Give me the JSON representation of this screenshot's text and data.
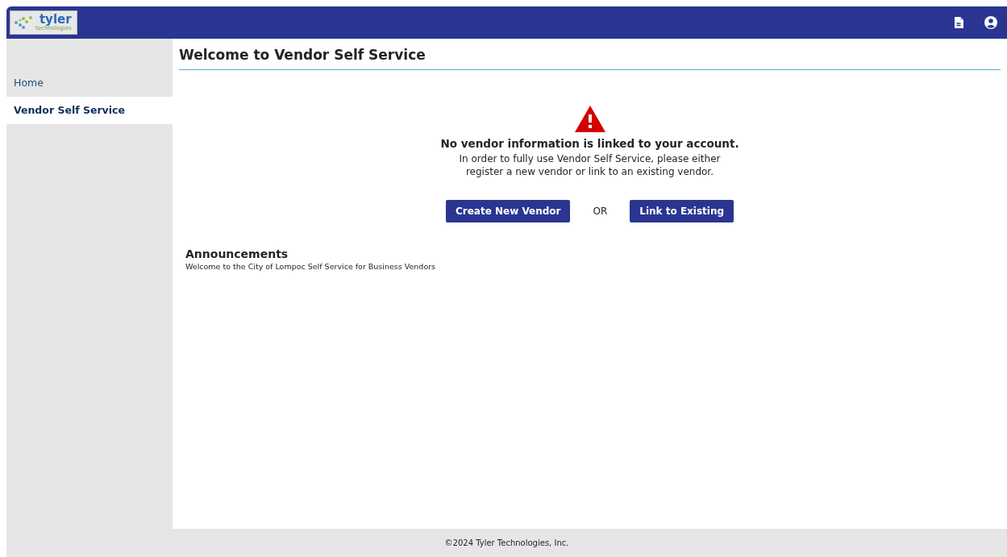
{
  "header": {
    "logo": {
      "name": "tyler",
      "tagline": "technologies"
    }
  },
  "sidebar": {
    "items": [
      {
        "label": "Home",
        "selected": false
      },
      {
        "label": "Vendor Self Service",
        "selected": true
      }
    ]
  },
  "page_title": "Welcome to Vendor Self Service",
  "notice": {
    "heading": "No vendor information is linked to your account.",
    "message": "In order to fully use Vendor Self Service, please either register a new vendor or link to an existing vendor."
  },
  "actions": {
    "primary": "Create New Vendor",
    "separator": "OR",
    "secondary": "Link to Existing"
  },
  "announcements": {
    "title": "Announcements",
    "text": "Welcome to the City of Lompoc Self Service for Business Vendors"
  },
  "footer": "©2024 Tyler Technologies, Inc."
}
